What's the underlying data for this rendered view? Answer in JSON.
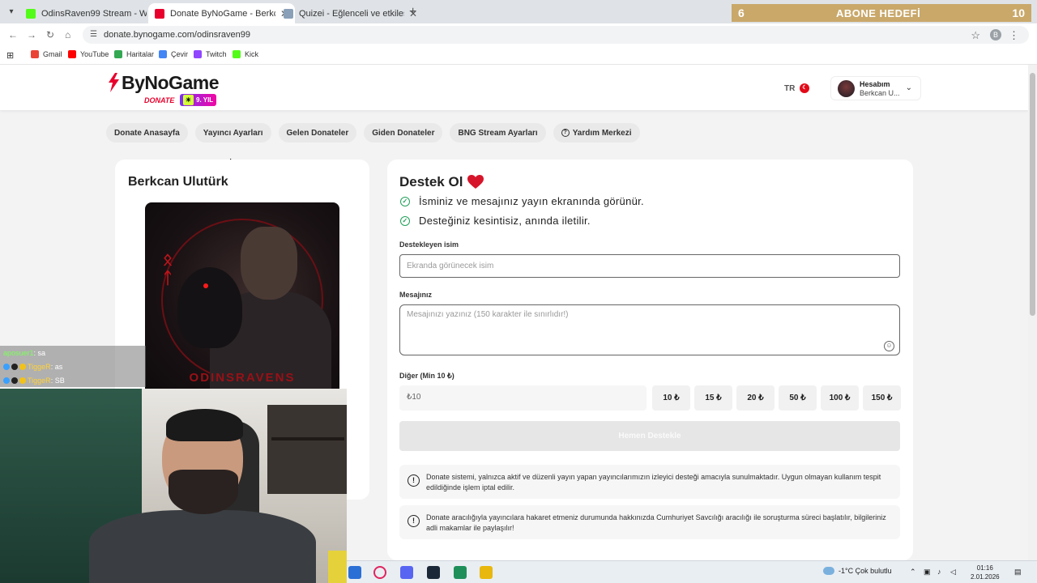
{
  "browser": {
    "tabs": [
      {
        "label": "OdinsRaven99 Stream - Watch",
        "icon_color": "#53fc18",
        "active": false
      },
      {
        "label": "Donate ByNoGame - Berkcan U",
        "icon_color": "#e8002d",
        "active": true
      },
      {
        "label": "Quizei - Eğlenceli ve etkileşimli",
        "icon_color": "#8aa0b8",
        "active": false
      }
    ],
    "url": "donate.bynogame.com/odinsraven99",
    "bookmarks": [
      {
        "label": "Gmail",
        "color": "#ea4335"
      },
      {
        "label": "YouTube",
        "color": "#ff0000"
      },
      {
        "label": "Haritalar",
        "color": "#34a853"
      },
      {
        "label": "Çevir",
        "color": "#4285f4"
      },
      {
        "label": "Twitch",
        "color": "#9146ff"
      },
      {
        "label": "Kick",
        "color": "#53fc18"
      }
    ],
    "profile_initial": "B"
  },
  "overlay": {
    "abone_current": "6",
    "abone_title": "ABONE HEDEFİ",
    "abone_target": "10"
  },
  "header": {
    "brand": "ByNoGame",
    "donate_tag": "DONATE",
    "years_badge": "9. YIL",
    "lang": "TR",
    "account_title": "Hesabım",
    "account_name": "Berkcan U..."
  },
  "subnav": [
    "Donate Anasayfa",
    "Yayıncı Ayarları",
    "Gelen Donateler",
    "Giden Donateler",
    "BNG Stream Ayarları",
    "Yardım Merkezi"
  ],
  "streamer": {
    "name": "Berkcan Ulutürk",
    "image_caption": "ODINSRAVENS"
  },
  "donate_form": {
    "title": "Destek Ol",
    "benefits": [
      "İsminiz ve mesajınız yayın ekranında görünür.",
      "Desteğiniz kesintisiz, anında iletilir."
    ],
    "name_label": "Destekleyen isim",
    "name_placeholder": "Ekranda görünecek isim",
    "message_label": "Mesajınız",
    "message_placeholder": "Mesajınızı yazınız (150 karakter ile sınırlıdır!)",
    "amount_label": "Diğer (Min 10 ₺)",
    "amount_value": "₺10",
    "amount_options": [
      "10 ₺",
      "15 ₺",
      "20 ₺",
      "50 ₺",
      "100 ₺",
      "150 ₺"
    ],
    "submit_label": "Hemen Destekle",
    "notices": [
      "Donate sistemi, yalnızca aktif ve düzenli yayın yapan yayıncılarımızın izleyici desteği amacıyla sunulmaktadır. Uygun olmayan kullanım tespit edildiğinde işlem iptal edilir.",
      "Donate aracılığıyla yayıncılara hakaret etmeniz durumunda hakkınızda Cumhuriyet Savcılığı aracılığı ile soruşturma süreci başlatılır, bilgileriniz adli makamlar ile paylaşılır!"
    ]
  },
  "chat": [
    {
      "user": "aposuer1",
      "text": ": sa"
    },
    {
      "user": "TiggeR",
      "text": ": as"
    },
    {
      "user": "TiggeR",
      "text": ": SB"
    }
  ],
  "taskbar": {
    "weather": "-1°C  Çok bulutlu",
    "time": "01:16",
    "date": "2.01.2026"
  }
}
